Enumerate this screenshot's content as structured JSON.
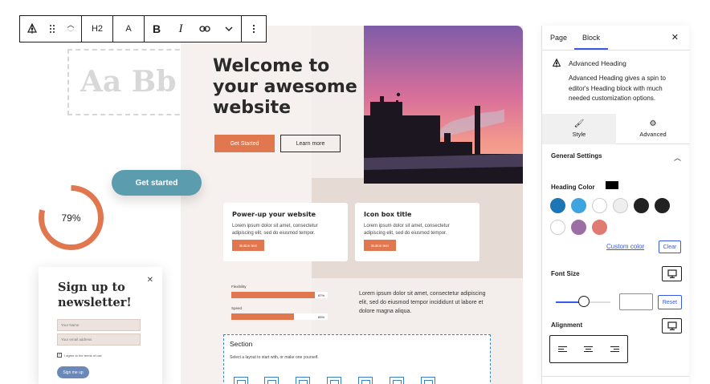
{
  "toolbar": {
    "heading_level": "H2",
    "text_label": "A",
    "bold_label": "B",
    "italic_label": "I",
    "link_icon": "link-icon",
    "more_icon": "chevron-down-icon",
    "options_icon": "more-vertical-icon"
  },
  "placeholder": {
    "text": "Aa Bb C"
  },
  "hero": {
    "title": "Welcome to your awesome website",
    "primary_button": "Get Started",
    "secondary_button": "Learn more"
  },
  "cards": [
    {
      "title": "Power-up your website",
      "text": "Lorem ipsum dolor sit amet, consectetur adipiscing elit, sed do eiusmod tempor.",
      "button": "Button text"
    },
    {
      "title": "Icon box title",
      "text": "Lorem ipsum dolor sit amet, consectetur adipiscing elit, sed do eiusmod tempor.",
      "button": "Button text"
    }
  ],
  "progress_bars": [
    {
      "label": "Flexibility",
      "value_text": "87%",
      "fraction": 0.87
    },
    {
      "label": "Speed",
      "value_text": "65%",
      "fraction": 0.65
    }
  ],
  "paragraph": "Lorem ipsum dolor sit amet, consectetur adipiscing elit, sed do eiusmod tempor incididunt ut labore et dolore magna aliqua.",
  "section": {
    "title": "Section",
    "subtitle": "Select a layout to start with, or make one yourself."
  },
  "pill_button": "Get started",
  "ring": {
    "label": "79%",
    "fraction": 0.79,
    "color": "#e0774f"
  },
  "newsletter": {
    "title": "Sign up to newsletter!",
    "name_placeholder": "Your Name",
    "email_placeholder": "Your email address",
    "terms_label": "I agree to the terms of use",
    "submit_label": "Sign me up"
  },
  "sidebar": {
    "tabs": [
      "Page",
      "Block"
    ],
    "active_tab": "Block",
    "block_title": "Advanced Heading",
    "block_description": "Advanced Heading gives a spin to editor's Heading block with much needed customization options.",
    "style_tabs": [
      {
        "label": "Style",
        "icon": "brush-icon"
      },
      {
        "label": "Advanced",
        "icon": "gear-icon"
      }
    ],
    "general_settings": "General Settings",
    "heading_color_label": "Heading Color",
    "heading_color_value": "#000000",
    "palette": [
      "#1c75b4",
      "#3fa5e0",
      "#ffffff",
      "#eeeeee",
      "#222222",
      "#222222",
      "#ffffff",
      "#9b6fa3",
      "#e07b72"
    ],
    "custom_color": "Custom color",
    "clear": "Clear",
    "font_size_label": "Font Size",
    "reset": "Reset",
    "alignment_label": "Alignment"
  },
  "colors": {
    "accent": "#e0774f",
    "wp_blue": "#3858e9",
    "pill": "#5b9caf"
  }
}
